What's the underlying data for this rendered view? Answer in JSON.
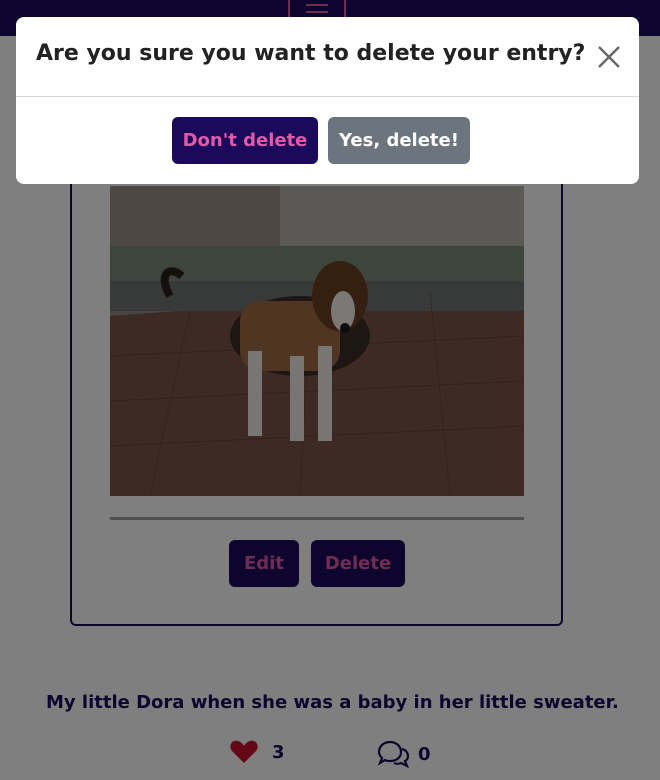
{
  "navbar": {
    "menu_icon": "hamburger-menu-icon"
  },
  "entry": {
    "photo_icon": "dog-photo",
    "edit_label": "Edit",
    "delete_label": "Delete",
    "caption": "My little Dora when she was a baby in her little sweater.",
    "likes": "3",
    "comments": "0",
    "like_icon": "heart-icon",
    "comment_icon": "comments-icon"
  },
  "modal": {
    "title": "Are you sure you want to delete your entry?",
    "keep_label": "Don't delete",
    "confirm_label": "Yes, delete!",
    "close_icon": "close-icon"
  },
  "colors": {
    "brand": "#1b0a5c",
    "accent": "#e05aa8",
    "secondary": "#6c757d",
    "heart": "#c8102e"
  }
}
